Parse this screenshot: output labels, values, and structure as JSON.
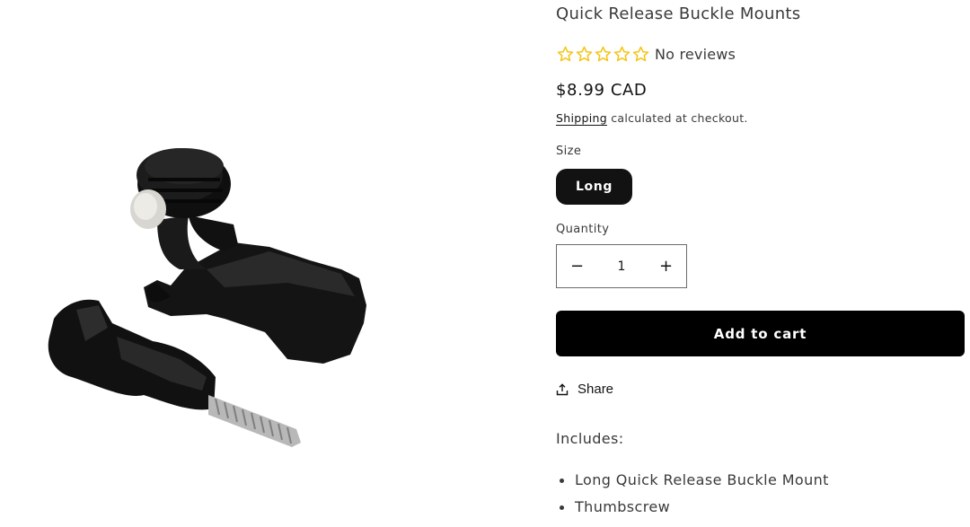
{
  "product": {
    "title": "Quick Release Buckle Mounts",
    "rating_stars": 0,
    "rating_max": 5,
    "reviews_label": "No reviews",
    "price": "$8.99 CAD",
    "shipping_link": "Shipping",
    "shipping_text": "calculated at checkout.",
    "size_label": "Size",
    "size_selected": "Long",
    "quantity_label": "Quantity",
    "quantity_value": "1",
    "quantity_minus": "−",
    "quantity_plus": "+",
    "add_to_cart": "Add to cart",
    "share_label": "Share",
    "includes_heading": "Includes:",
    "includes_items": [
      "Long Quick Release Buckle Mount",
      "Thumbscrew"
    ]
  },
  "colors": {
    "star": "#f5c518",
    "button_bg": "#000000",
    "pill_bg": "#121212"
  },
  "icons": [
    "star-outline-icon",
    "share-icon",
    "minus-icon",
    "plus-icon"
  ]
}
